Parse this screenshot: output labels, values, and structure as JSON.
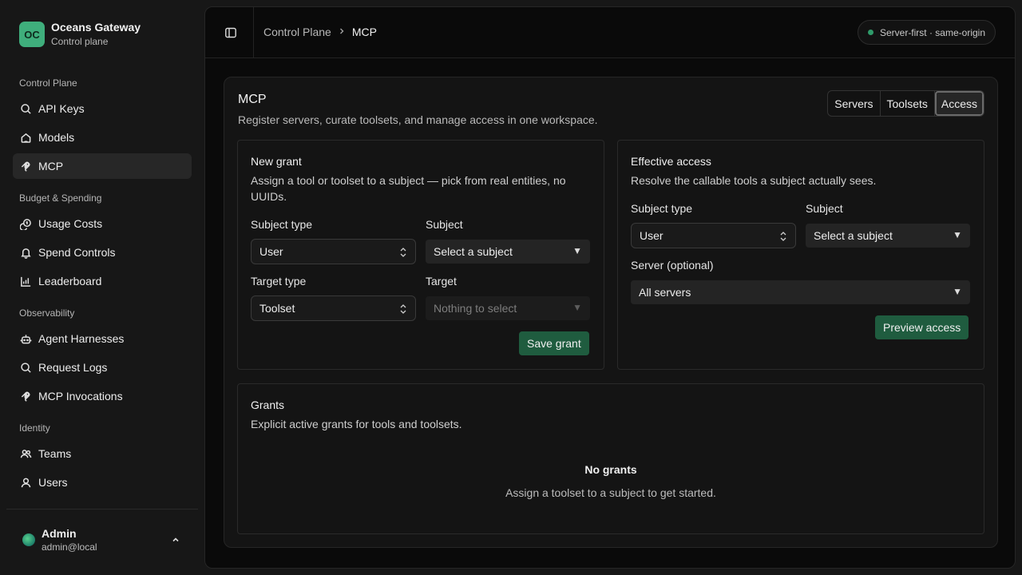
{
  "brand": {
    "logo_text": "OC",
    "name": "Oceans Gateway",
    "subtitle": "Control plane"
  },
  "sidebar": {
    "sections": [
      {
        "label": "Control Plane"
      },
      {
        "label": "Budget & Spending"
      },
      {
        "label": "Observability"
      },
      {
        "label": "Identity"
      }
    ],
    "items": [
      {
        "label": "API Keys",
        "icon": "search-icon"
      },
      {
        "label": "Models",
        "icon": "home-icon"
      },
      {
        "label": "MCP",
        "icon": "mcp-icon",
        "active": true
      },
      {
        "label": "Usage Costs",
        "icon": "coins-icon"
      },
      {
        "label": "Spend Controls",
        "icon": "bell-icon"
      },
      {
        "label": "Leaderboard",
        "icon": "chart-icon"
      },
      {
        "label": "Agent Harnesses",
        "icon": "bot-icon"
      },
      {
        "label": "Request Logs",
        "icon": "search-icon"
      },
      {
        "label": "MCP Invocations",
        "icon": "mcp-icon"
      },
      {
        "label": "Teams",
        "icon": "users-icon"
      },
      {
        "label": "Users",
        "icon": "user-icon"
      }
    ]
  },
  "user": {
    "name": "Admin",
    "email": "admin@local"
  },
  "topbar": {
    "breadcrumb": {
      "parent": "Control Plane",
      "current": "MCP"
    },
    "badge": "Server-first · same-origin",
    "badge_color": "#2f9b6a"
  },
  "page": {
    "title": "MCP",
    "description": "Register servers, curate toolsets, and manage access in one workspace.",
    "tabs": [
      {
        "label": "Servers"
      },
      {
        "label": "Toolsets"
      },
      {
        "label": "Access",
        "active": true
      }
    ]
  },
  "new_grant": {
    "title": "New grant",
    "description_line1": "Assign a tool or toolset to a subject — pick from real entities, no",
    "description_line2": "UUIDs.",
    "subject_type_label": "Subject type",
    "subject_type_value": "User",
    "subject_label": "Subject",
    "subject_value": "Select a subject",
    "target_type_label": "Target type",
    "target_type_value": "Toolset",
    "target_label": "Target",
    "target_value": "Nothing to select",
    "save_label": "Save grant"
  },
  "effective_access": {
    "title": "Effective access",
    "description": "Resolve the callable tools a subject actually sees.",
    "subject_type_label": "Subject type",
    "subject_type_value": "User",
    "subject_label": "Subject",
    "subject_value": "Select a subject",
    "server_label": "Server (optional)",
    "server_value": "All servers",
    "preview_label": "Preview access"
  },
  "grants": {
    "title": "Grants",
    "description": "Explicit active grants for tools and toolsets.",
    "empty_title": "No grants",
    "empty_description": "Assign a toolset to a subject to get started."
  },
  "colors": {
    "accent": "#1f5c3f",
    "brand": "#3fae7c"
  }
}
